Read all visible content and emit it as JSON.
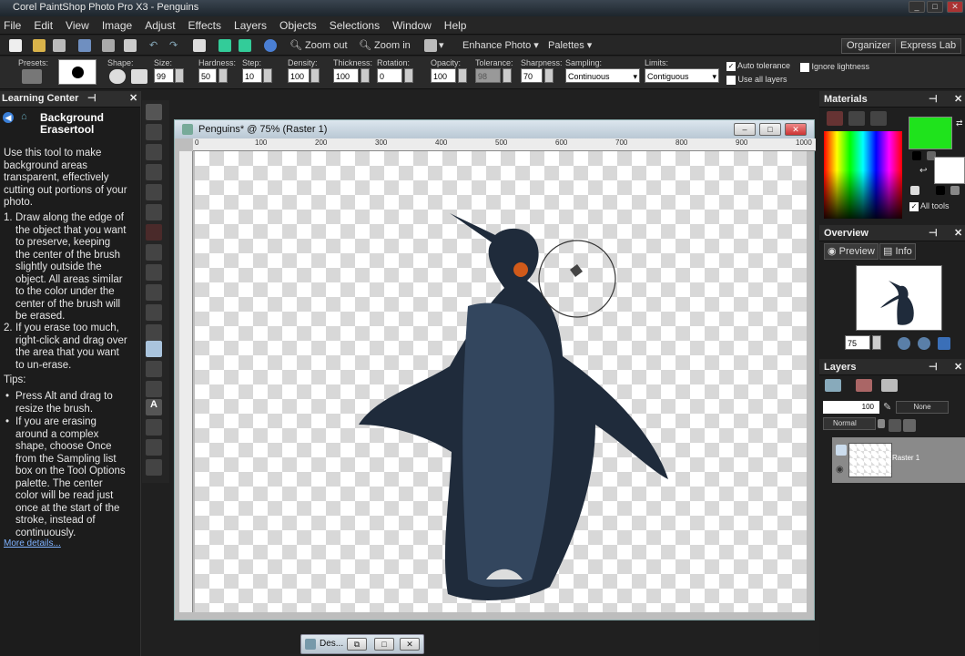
{
  "app": {
    "title": "Corel PaintShop Photo Pro X3 - Penguins"
  },
  "menu": [
    "File",
    "Edit",
    "View",
    "Image",
    "Adjust",
    "Effects",
    "Layers",
    "Objects",
    "Selections",
    "Window",
    "Help"
  ],
  "toolbar": {
    "zoom_out": "Zoom out",
    "zoom_in": "Zoom in",
    "enhance": "Enhance Photo",
    "palettes": "Palettes",
    "organizer": "Organizer",
    "express_lab": "Express Lab"
  },
  "options": {
    "presets_label": "Presets:",
    "size_label": "Size:",
    "size": "99",
    "shape_label": "Shape:",
    "hardness_label": "Hardness:",
    "hardness": "50",
    "step_label": "Step:",
    "step": "10",
    "density_label": "Density:",
    "density": "100",
    "thickness_label": "Thickness:",
    "thickness": "100",
    "rotation_label": "Rotation:",
    "rotation": "0",
    "opacity_label": "Opacity:",
    "opacity": "100",
    "tolerance_label": "Tolerance:",
    "tolerance": "98",
    "sharpness_label": "Sharpness:",
    "sharpness": "70",
    "sampling_label": "Sampling:",
    "sampling": "Continuous",
    "limits_label": "Limits:",
    "limits": "Contiguous",
    "auto_tolerance": "Auto tolerance",
    "use_all_layers": "Use all layers",
    "ignore_lightness": "Ignore lightness"
  },
  "learning": {
    "header": "Learning Center",
    "tool_title1": "Background",
    "tool_title2": "Erasertool",
    "intro": "Use this tool to make background areas transparent, effectively cutting out portions of your photo.",
    "steps": [
      "Draw along the edge of the object that you want to preserve, keeping the center of the brush slightly outside the object. All areas similar to the color under the center of the brush will be erased.",
      "If you erase too much, right-click and drag over the area that you want to un-erase."
    ],
    "tips_label": "Tips:",
    "tips": [
      "Press Alt and drag to resize the brush.",
      "If you are erasing around a complex shape, choose Once from the Sampling list box on the Tool Options palette. The center color will be read just once at the start of the stroke, instead of continuously."
    ],
    "more": "More details..."
  },
  "document": {
    "title": "Penguins* @  75% (Raster 1)",
    "ruler_top": [
      "100",
      "200",
      "300",
      "400",
      "500",
      "600",
      "700",
      "800",
      "900",
      "1000"
    ]
  },
  "materials": {
    "header": "Materials",
    "all_tools": "All tools",
    "fg_color": "#1fe31c"
  },
  "overview": {
    "header": "Overview",
    "tab_preview": "Preview",
    "tab_info": "Info",
    "zoom": "75"
  },
  "layers": {
    "header": "Layers",
    "opacity": "100",
    "mode": "None",
    "blend": "Normal",
    "layer_name": "Raster 1"
  },
  "taskbar": {
    "label": "Des..."
  }
}
